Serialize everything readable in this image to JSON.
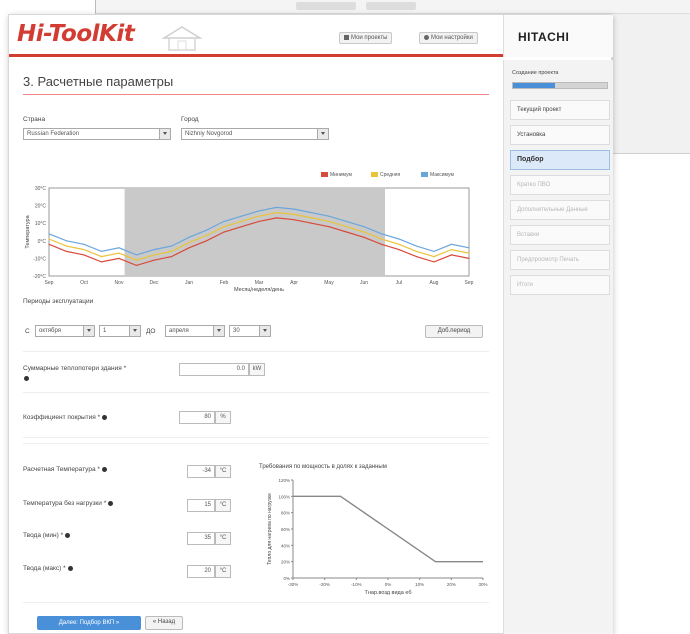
{
  "header": {
    "logo": "Hi-ToolKit",
    "buttons": [
      "Мои проекты",
      "Мои настройки"
    ],
    "brand": "HITACHI"
  },
  "section": {
    "title": "3. Расчетные параметры"
  },
  "location": {
    "country_label": "Страна",
    "country_value": "Russian Federation",
    "city_label": "Город",
    "city_value": "Nizhniy Novgorod"
  },
  "temp_chart": {
    "ylabel": "Температура",
    "xlabel": "Месяц/неделя/день",
    "legend": [
      "Минимум",
      "Средняя",
      "Максимум"
    ],
    "ytick_labels": [
      "30°C",
      "20°C",
      "10°C",
      "0°C",
      "-10°C",
      "-20°C"
    ],
    "xtick_labels": [
      "Sep",
      "Oct",
      "Nov",
      "Dec",
      "Jan",
      "Feb",
      "Mar",
      "Apr",
      "May",
      "Jun",
      "Jul",
      "Aug",
      "Sep"
    ]
  },
  "period": {
    "label": "Периоды эксплуатации",
    "from_label": "С",
    "from_month": "октября",
    "from_day": "1",
    "to_label": "ДО",
    "to_month": "апреля",
    "to_day": "30",
    "add_button": "Доб.период"
  },
  "fields": {
    "heat_loss_label": "Суммарные теплопотери здания *",
    "heat_loss_value": "0.0",
    "heat_loss_unit": "kW",
    "coverage_label": "Коэффициент покрытия *",
    "coverage_value": "80",
    "coverage_unit": "%",
    "design_temp_label": "Расчетная Температура *",
    "design_temp_value": "-34",
    "design_temp_unit": "°C",
    "no_load_temp_label": "Температура без нагрузки *",
    "no_load_temp_value": "15",
    "no_load_temp_unit": "°C",
    "supply_min_label": "Твода (мин) *",
    "supply_min_value": "35",
    "supply_min_unit": "°C",
    "supply_max_label": "Твода (макс) *",
    "supply_max_value": "20",
    "supply_max_unit": "°C"
  },
  "heat_chart": {
    "title": "Требования по мощность в долях к заданным",
    "ylabel": "Тепло для нагрева по нагрузке",
    "xlabel": "Тнар.возд вида еб",
    "ytick_labels": [
      "120%",
      "100%",
      "80%",
      "60%",
      "40%",
      "20%",
      "0%"
    ],
    "xtick_labels": [
      "-30%",
      "-20%",
      "-10%",
      "0%",
      "10%",
      "20%",
      "30%"
    ]
  },
  "footer_buttons": {
    "next": "Далее: Подбор ВКП »",
    "back": "« Назад"
  },
  "sidebar": {
    "status_label": "Создание проекта",
    "progress": 0.45,
    "items": [
      {
        "label": "Текущий проект",
        "state": "done"
      },
      {
        "label": "Установка",
        "state": "done"
      },
      {
        "label": "Подбор",
        "state": "active"
      },
      {
        "label": "Кратко ПВО",
        "state": "dim"
      },
      {
        "label": "Дополнительные Данные",
        "state": "dim"
      },
      {
        "label": "Вставки",
        "state": "dim"
      },
      {
        "label": "Предпросмотр Печать",
        "state": "dim"
      },
      {
        "label": "Итоги",
        "state": "dim"
      }
    ]
  },
  "colors": {
    "brand_red": "#d23c33",
    "accent_blue": "#4a90d9",
    "series_min": "#d84a3a",
    "series_avg": "#e8c43a",
    "series_max": "#6aa6dc"
  },
  "chart_data": [
    {
      "type": "line",
      "title": "",
      "xlabel": "Месяц/неделя/день",
      "ylabel": "Температура",
      "ylim": [
        -20,
        30
      ],
      "legend_placement": "top-right",
      "grid": false,
      "x": [
        0,
        1,
        2,
        3,
        4,
        5,
        6,
        7,
        8,
        9,
        10,
        11,
        12,
        13,
        14,
        15,
        16,
        17,
        18,
        19,
        20,
        21,
        22,
        23,
        24
      ],
      "series": [
        {
          "name": "Минимум",
          "values": [
            -2,
            -6,
            -8,
            -12,
            -10,
            -14,
            -11,
            -9,
            -4,
            0,
            5,
            8,
            11,
            13,
            12,
            10,
            8,
            5,
            2,
            -2,
            -5,
            -9,
            -12,
            -8,
            -10
          ]
        },
        {
          "name": "Средняя",
          "values": [
            1,
            -3,
            -5,
            -9,
            -7,
            -11,
            -8,
            -6,
            -1,
            3,
            8,
            11,
            14,
            16,
            15,
            13,
            11,
            8,
            5,
            1,
            -2,
            -6,
            -9,
            -5,
            -7
          ]
        },
        {
          "name": "Максимум",
          "values": [
            4,
            0,
            -2,
            -6,
            -4,
            -8,
            -5,
            -3,
            2,
            6,
            11,
            14,
            17,
            19,
            18,
            16,
            14,
            11,
            8,
            4,
            1,
            -3,
            -6,
            -2,
            -4
          ]
        }
      ]
    },
    {
      "type": "line",
      "title": "Требования по мощность в долях к заданным",
      "xlabel": "Тнар.возд вида еб",
      "ylabel": "Тепло для нагрева по нагрузке",
      "xlim": [
        -30,
        30
      ],
      "ylim": [
        0,
        120
      ],
      "series": [
        {
          "values": [
            [
              -30,
              100
            ],
            [
              -15,
              100
            ],
            [
              15,
              20
            ],
            [
              30,
              20
            ]
          ]
        }
      ]
    }
  ]
}
